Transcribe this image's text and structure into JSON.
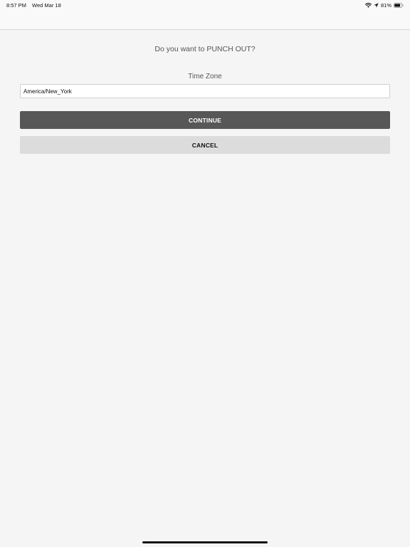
{
  "status_bar": {
    "time": "8:57 PM",
    "date": "Wed Mar 18",
    "battery_percent": "81%",
    "battery_level": 0.81,
    "icons": [
      "wifi-icon",
      "location-arrow-icon",
      "battery-icon"
    ]
  },
  "dialog": {
    "prompt": "Do you want to PUNCH OUT?",
    "timezone_label": "Time Zone",
    "timezone_value": "America/New_York",
    "continue_label": "CONTINUE",
    "cancel_label": "CANCEL"
  },
  "colors": {
    "background": "#f5f5f5",
    "continue_button": "#575757",
    "cancel_button": "#dcdcdc"
  }
}
